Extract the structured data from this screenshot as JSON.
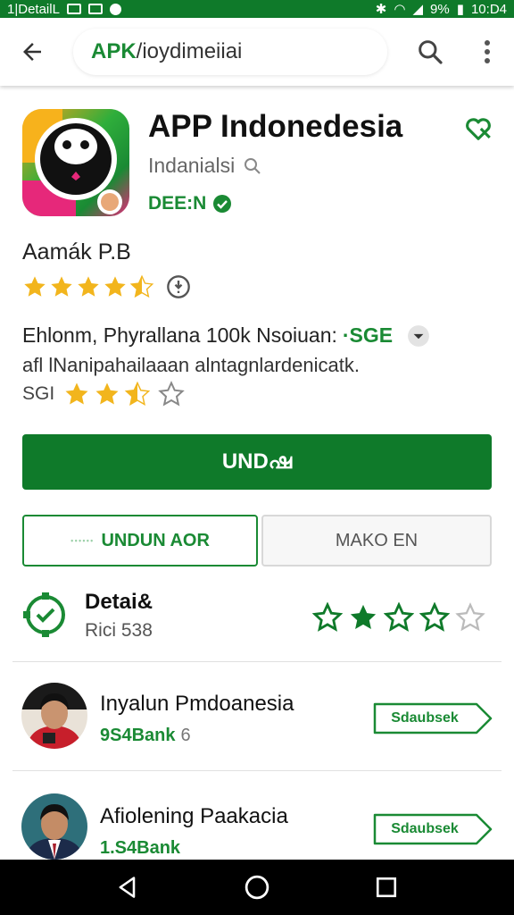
{
  "status_bar": {
    "left_text": "1|DetailL",
    "battery_text": "9%",
    "time": "10:D4"
  },
  "app_bar": {
    "search_prefix": "APK",
    "search_rest": "/ioydimeiiai",
    "icons": [
      "arrow-back-icon",
      "search-icon",
      "more-vert-icon"
    ]
  },
  "app": {
    "title": "APP Indonedesia",
    "developer": "Indanialsi",
    "badge": "DEE:N",
    "rating_label": "Aamák P.B",
    "rating_stars": 4.5
  },
  "description": {
    "line1": "Ehlonm, Phyrallana 100k Nsoiuan:",
    "line1_green": "·SGE",
    "line2": "afl lNanipahailaaan alntagnlardenicatk.",
    "rating_num": "SGI",
    "rating_stars": 2.5
  },
  "buttons": {
    "install": "UNDഷ",
    "outline_faint": "ꞏꞏꞏꞏꞏꞏ",
    "outline": "UNDUN AOR",
    "secondary": "MAKO EN"
  },
  "details": {
    "title": "Detai&",
    "subtitle": "Rici 538",
    "stars": 2
  },
  "list": [
    {
      "title": "Inyalun Pmdoanesia",
      "sub_green": "9S4Bank",
      "sub_grey": "6",
      "button": "Sdaubsek"
    },
    {
      "title": "Afiolening Paakacia",
      "sub_green": "1.S4Bank",
      "sub_grey": "",
      "button": "Sdaubsek"
    }
  ],
  "colors": {
    "primary_green": "#0f7a2a",
    "accent_green": "#1a8a34",
    "star_gold": "#f2b51d"
  }
}
